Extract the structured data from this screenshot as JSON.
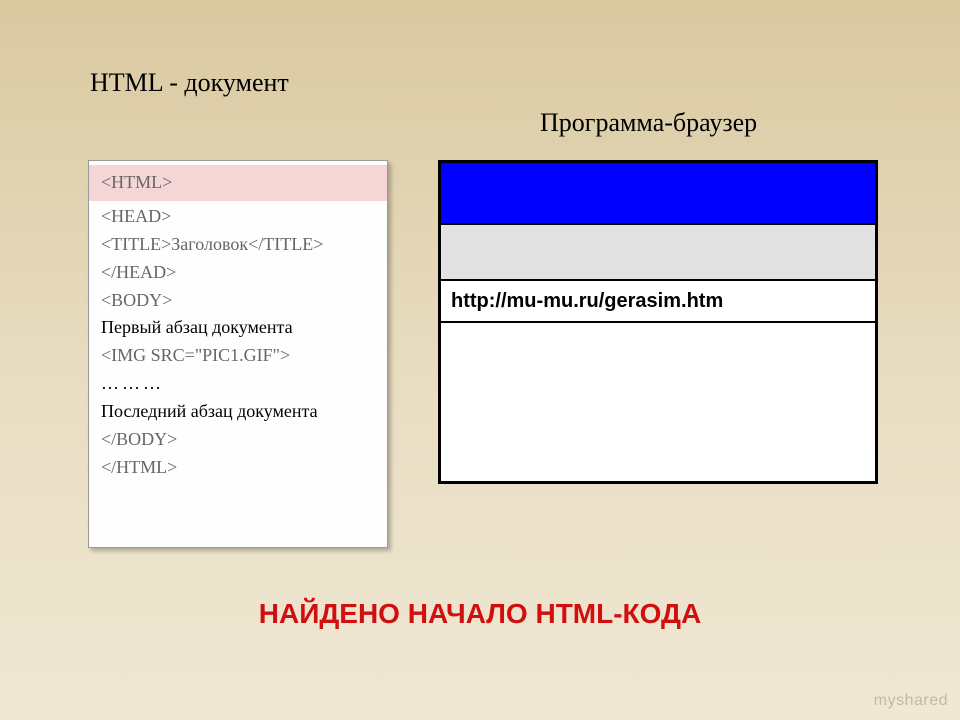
{
  "titles": {
    "left": "HTML - документ",
    "right": "Программа-браузер"
  },
  "code": {
    "line_html_open": "<HTML>",
    "line_head_open": "<HEAD>",
    "line_title": "<TITLE>Заголовок</TITLE>",
    "line_head_close": "</HEAD>",
    "line_body_open": "<BODY>",
    "line_first_para": "Первый абзац документа",
    "line_img": "<IMG SRC=\"PIC1.GIF\">",
    "line_dots": "………",
    "line_last_para": "Последний абзац документа",
    "line_body_close": "</BODY>",
    "line_html_close": "</HTML>"
  },
  "browser": {
    "address": "http://mu-mu.ru/gerasim.htm"
  },
  "status": "НАЙДЕНО НАЧАЛО HTML-КОДА",
  "watermark": "myshared"
}
